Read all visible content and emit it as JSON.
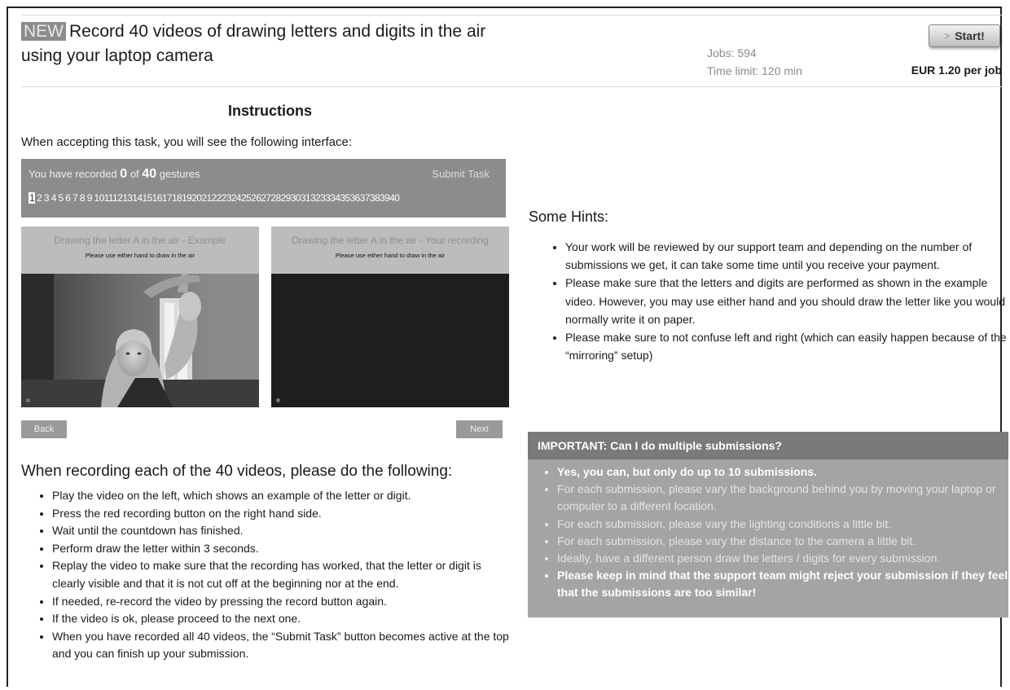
{
  "header": {
    "badge": "NEW",
    "title": "Record 40 videos of drawing letters and digits in the air using your laptop camera",
    "jobs": "Jobs: 594",
    "time_limit": "Time limit: 120 min",
    "price": "EUR 1.20 per job",
    "start_label": "Start!"
  },
  "instructions": {
    "heading": "Instructions",
    "intro": "When accepting this task, you will see the following interface:"
  },
  "interface": {
    "count_prefix": "You have recorded",
    "count_value": "0",
    "count_mid": "of",
    "count_total": "40",
    "count_suffix": "gestures",
    "submit_label": "Submit Task",
    "selected_number": "1",
    "numbers": "2 3 4 5 6 7 8 9 10111213141516171819202122232425262728293031323334353637383940",
    "left_panel": {
      "title": "Drawing the letter A in the air - Example",
      "subtitle": "Please use either hand to draw in the air"
    },
    "right_panel": {
      "title": "Drawing the letter A in the air - Your recording",
      "subtitle": "Please use either hand to draw in the air"
    },
    "back_label": "Back",
    "next_label": "Next"
  },
  "recording": {
    "heading": "When recording each of the 40 videos, please do the following:",
    "steps": [
      "Play the video on the left, which shows an example of the letter or digit.",
      "Press the red recording button on the right hand side.",
      "Wait until the countdown has finished.",
      "Perform draw the letter within 3 seconds.",
      "Replay the video to make sure that the recording has worked, that the letter or digit is clearly visible and that it is not cut off at the beginning nor at the end.",
      "If needed, re-record the video by pressing the record button again.",
      "If the video is ok, please proceed to the next one.",
      "When you have recorded all 40 videos, the “Submit Task” button becomes active at the top and you can finish up your submission."
    ]
  },
  "hints": {
    "heading": "Some Hints:",
    "items": [
      "Your work will be reviewed by our support team and depending on the number of submissions we get, it can take some time until you receive your payment.",
      "Please make sure that the letters and digits are performed as shown in the example video. However, you may use either hand and you should draw the letter like you would normally write it on paper.",
      "Please make sure to not confuse left and right (which can easily happen because of the “mirroring” setup)"
    ]
  },
  "important": {
    "heading": "IMPORTANT: Can I do multiple submissions?",
    "items": [
      "Yes, you can, but only do up to 10 submissions.",
      "For each submission, please vary the background behind you by moving your laptop or computer to a different location.",
      "For each submission, please vary the lighting conditions a little bit.",
      "For each submission, please vary the distance to the camera a little bit.",
      "Ideally, have a different person draw the letters / digits for every submission.",
      "Please keep in mind that the support team might reject your submission if they feel that the submissions are too similar!"
    ]
  },
  "icons": {
    "start_arrow": "arrow-right-icon",
    "recording_dot": "record-indicator-icon"
  },
  "colors": {
    "bar_bg": "#8c8c8c",
    "important_head": "#7a7a7a",
    "important_body": "#a4a4a4"
  }
}
